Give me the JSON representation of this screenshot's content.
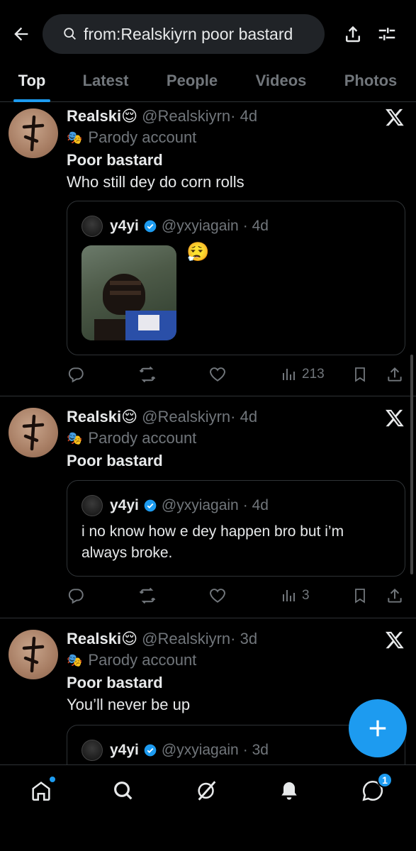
{
  "search": {
    "query": "from:Realskiyrn poor bastard"
  },
  "tabs": [
    {
      "label": "Top",
      "active": true
    },
    {
      "label": "Latest",
      "active": false
    },
    {
      "label": "People",
      "active": false
    },
    {
      "label": "Videos",
      "active": false
    },
    {
      "label": "Photos",
      "active": false
    }
  ],
  "posts": [
    {
      "name": "Realski",
      "emoji": "😌",
      "handle": "@Realskiyrn",
      "time": "· 4d",
      "parody": "Parody account",
      "title": "Poor bastard",
      "text": "Who still dey do corn rolls",
      "quote": {
        "name": "y4yi",
        "handle": "@yxyiagain",
        "time": "· 4d",
        "emoji": "😮‍💨",
        "text": ""
      },
      "views": "213"
    },
    {
      "name": "Realski",
      "emoji": "😌",
      "handle": "@Realskiyrn",
      "time": "· 4d",
      "parody": "Parody account",
      "title": "Poor bastard",
      "text": "",
      "quote": {
        "name": "y4yi",
        "handle": "@yxyiagain",
        "time": "· 4d",
        "text1": "i no know how e dey happen bro but i’m",
        "text2": "always broke."
      },
      "views": "3"
    },
    {
      "name": "Realski",
      "emoji": "😌",
      "handle": "@Realskiyrn",
      "time": "· 3d",
      "parody": "Parody account",
      "title": "Poor bastard",
      "text": "You’ll never be up",
      "quote": {
        "name": "y4yi",
        "handle": "@yxyiagain",
        "time": "· 3d"
      }
    }
  ],
  "nav": {
    "messages_badge": "1"
  },
  "colors": {
    "accent": "#1d9bf0",
    "muted": "#71767b",
    "bg": "#000000"
  }
}
